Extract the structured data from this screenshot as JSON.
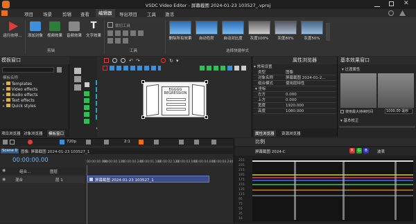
{
  "window": {
    "title": "VSDC Video Editor - 屏幕截图 2024-01-23 103527_.vproj"
  },
  "menu": {
    "items": [
      "项目",
      "场景",
      "剪辑",
      "查看",
      "编辑器",
      "导出项目",
      "工具",
      "激活"
    ],
    "active": "编辑器"
  },
  "ribbon": {
    "run_label": "运行向导...",
    "add_object": "添加对象",
    "video_effects": "视频效果",
    "audio_effects": "音频效果",
    "text_effects": "文字效果",
    "cut_group": "剪辑",
    "crop_tools": "裁切工具",
    "tools_group": "工具",
    "quick_styles": [
      "删除所有效果",
      "自动色阶",
      "自动对比度",
      "灰度100%",
      "灰度80%",
      "灰度50%"
    ],
    "quick_group": "选择快捷样式"
  },
  "template_panel": {
    "title": "模板窗口",
    "filter_label": "模板名称",
    "items": [
      "Templates",
      "Video effects",
      "Audio effects",
      "Text effects",
      "Quick styles"
    ],
    "tabs": [
      "项目浏览器",
      "对象浏览器",
      "模板窗口"
    ]
  },
  "viewer": {
    "zoom": "720p",
    "fit": "2:1",
    "doc_title": "EGGGG REGRESSION"
  },
  "properties": {
    "title": "属性浏览器",
    "rows": [
      [
        "类型",
        "图像"
      ],
      [
        "对象名称",
        "屏幕截图 2024-01-2..."
      ],
      [
        "组合模式",
        "使用层特性"
      ]
    ],
    "common": "常用设置",
    "coords": "坐标",
    "coord_rows": [
      [
        "左方",
        "0.000"
      ],
      [
        "上方",
        "0.000"
      ],
      [
        "宽度",
        "1920.000"
      ],
      [
        "高度",
        "1080.000"
      ]
    ],
    "tabs": [
      "属性浏览器",
      "资源浏览器"
    ]
  },
  "basic_effects": {
    "title": "基本效果窗口",
    "section": "过渡属性",
    "checkbox": "使用最大持续时间",
    "duration": "1000.00 毫秒",
    "correction": "基本校正"
  },
  "timeline": {
    "tab": "Scene 0",
    "clip_path": "图像: 屏幕截图 2024-01-23 103527_1",
    "timecode": "00:00:00.00",
    "ruler": [
      "00:00:00.000",
      "00:00:00.120",
      "00:00:00.240",
      "00:00:01.180",
      "00:00:02.120",
      "00:00:03.060",
      "00:00:04.000",
      "00:00:04.240"
    ],
    "layer_label": "组合...",
    "layer_name": "图层",
    "track_label": "混合",
    "track_layer": "层 1",
    "clip_name": "屏幕截图 2024-01-23 103527_1"
  },
  "scope": {
    "title": "比例",
    "source": "屏幕截图 2024-C",
    "mode": "波表",
    "channels": [
      "R",
      "G",
      "B"
    ],
    "y_labels": [
      "255",
      "235",
      "215",
      "195",
      "175",
      "155",
      "135",
      "115",
      "95",
      "75",
      "55",
      "35",
      "16"
    ]
  },
  "colors": {
    "accent": "#3c8fd8",
    "orange": "#e8701a",
    "clip": "#3b4c86"
  }
}
